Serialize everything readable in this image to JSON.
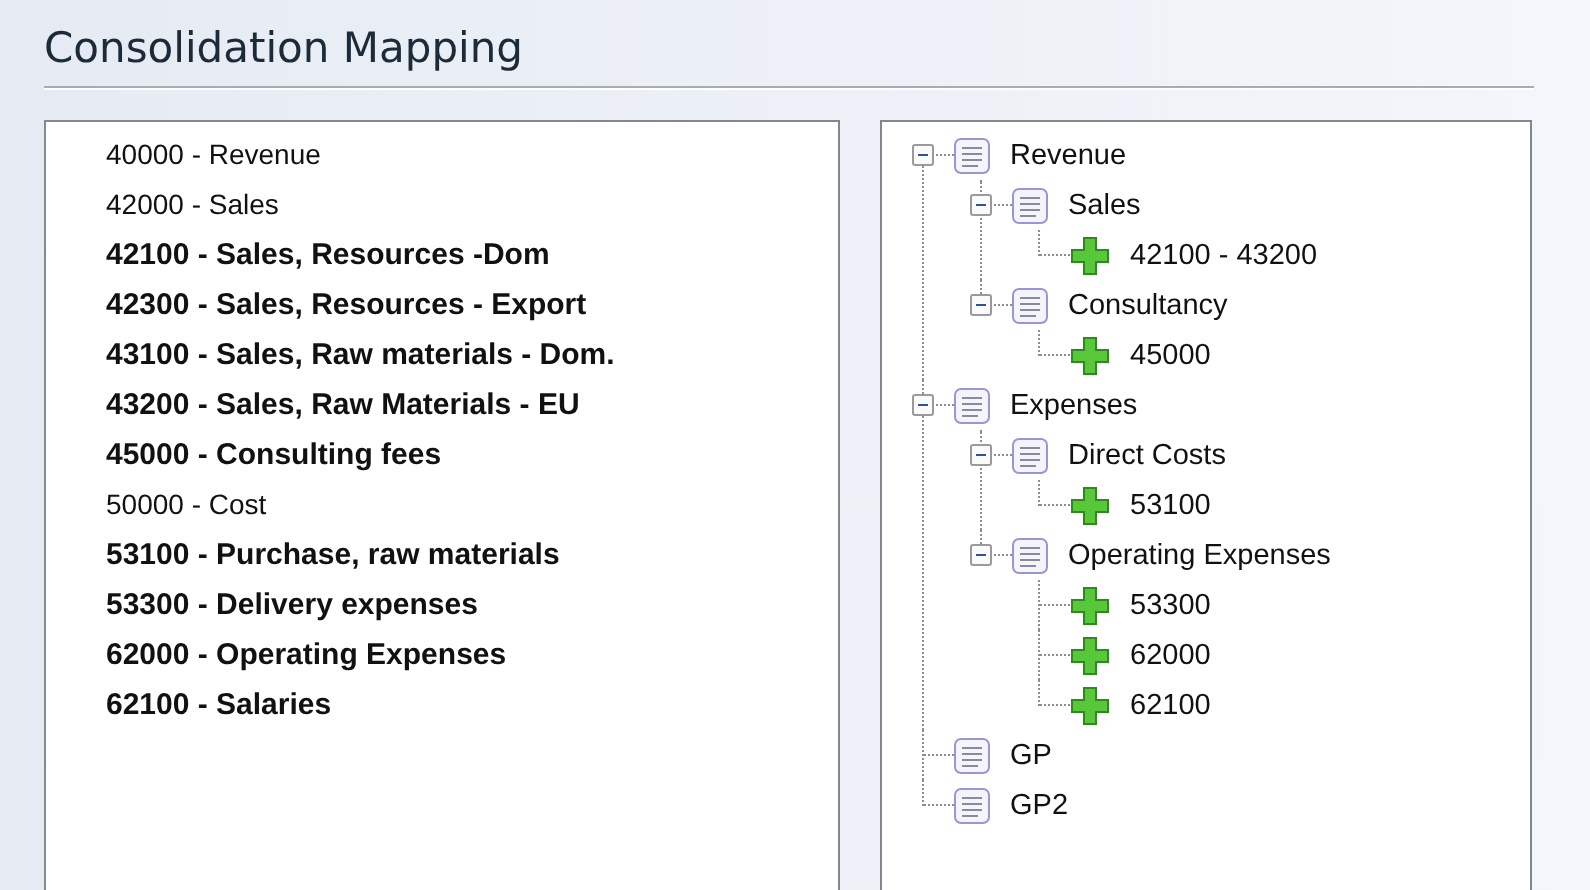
{
  "title": "Consolidation Mapping",
  "accounts": [
    {
      "label": "40000 - Revenue",
      "bold": false
    },
    {
      "label": "42000 - Sales",
      "bold": false
    },
    {
      "label": "42100 - Sales, Resources -Dom",
      "bold": true
    },
    {
      "label": "42300 - Sales, Resources - Export",
      "bold": true
    },
    {
      "label": "43100 - Sales, Raw materials - Dom.",
      "bold": true
    },
    {
      "label": "43200 - Sales, Raw Materials - EU",
      "bold": true
    },
    {
      "label": "45000 - Consulting fees",
      "bold": true
    },
    {
      "label": "50000 - Cost",
      "bold": false
    },
    {
      "label": "53100 - Purchase, raw materials",
      "bold": true
    },
    {
      "label": "53300 - Delivery expenses",
      "bold": true
    },
    {
      "label": "62000 - Operating Expenses",
      "bold": true
    },
    {
      "label": "62100 - Salaries",
      "bold": true
    }
  ],
  "tree": [
    {
      "kind": "group",
      "label": "Revenue",
      "expanded": true,
      "children": [
        {
          "kind": "group",
          "label": "Sales",
          "expanded": true,
          "children": [
            {
              "kind": "account",
              "label": "42100 - 43200"
            }
          ]
        },
        {
          "kind": "group",
          "label": "Consultancy",
          "expanded": true,
          "children": [
            {
              "kind": "account",
              "label": "45000"
            }
          ]
        }
      ]
    },
    {
      "kind": "group",
      "label": "Expenses",
      "expanded": true,
      "children": [
        {
          "kind": "group",
          "label": "Direct Costs",
          "expanded": true,
          "children": [
            {
              "kind": "account",
              "label": "53100"
            }
          ]
        },
        {
          "kind": "group",
          "label": "Operating Expenses",
          "expanded": true,
          "children": [
            {
              "kind": "account",
              "label": "53300"
            },
            {
              "kind": "account",
              "label": "62000"
            },
            {
              "kind": "account",
              "label": "62100"
            }
          ]
        }
      ]
    },
    {
      "kind": "group",
      "label": "GP"
    },
    {
      "kind": "group",
      "label": "GP2"
    }
  ]
}
